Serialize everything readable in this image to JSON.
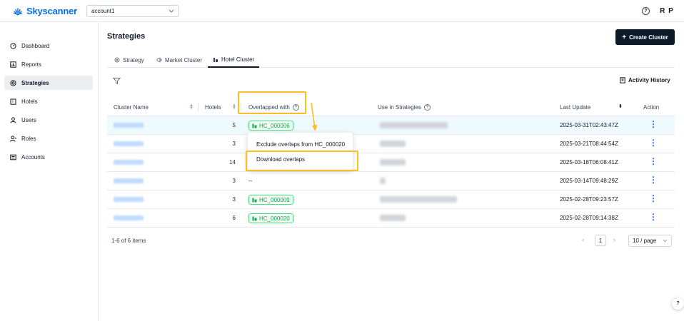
{
  "brand": {
    "name": "Skyscanner",
    "color": "#0770e3"
  },
  "account": {
    "value": "account1"
  },
  "user": {
    "initials": "R P"
  },
  "sidebar": {
    "items": [
      {
        "label": "Dashboard",
        "icon": "dashboard-icon",
        "active": false
      },
      {
        "label": "Reports",
        "icon": "reports-icon",
        "active": false
      },
      {
        "label": "Strategies",
        "icon": "strategies-icon",
        "active": true
      },
      {
        "label": "Hotels",
        "icon": "hotels-icon",
        "active": false
      },
      {
        "label": "Users",
        "icon": "users-icon",
        "active": false
      },
      {
        "label": "Roles",
        "icon": "roles-icon",
        "active": false
      },
      {
        "label": "Accounts",
        "icon": "accounts-icon",
        "active": false
      }
    ]
  },
  "main": {
    "title": "Strategies",
    "create_button": "Create Cluster",
    "tabs": [
      {
        "label": "Strategy",
        "active": false
      },
      {
        "label": "Market Cluster",
        "active": false
      },
      {
        "label": "Hotel Cluster",
        "active": true
      }
    ],
    "activity_history": "Activity History"
  },
  "table": {
    "columns": {
      "cluster_name": "Cluster Name",
      "hotels": "Hotels",
      "overlapped_with": "Overlapped with",
      "use_in_strategies": "Use in Strategies",
      "last_update": "Last Update",
      "action": "Action"
    },
    "rows": [
      {
        "hotels": "5",
        "overlapped": "HC_000006",
        "last_update": "2025-03-31T02:43:47Z"
      },
      {
        "hotels": "3",
        "overlapped": "",
        "last_update": "2025-03-21T08:44:54Z"
      },
      {
        "hotels": "14",
        "overlapped": "",
        "last_update": "2025-03-18T06:08:41Z"
      },
      {
        "hotels": "3",
        "overlapped": "--",
        "last_update": "2025-03-14T09:48:29Z"
      },
      {
        "hotels": "3",
        "overlapped": "HC_000009",
        "last_update": "2025-02-28T09:23:57Z"
      },
      {
        "hotels": "6",
        "overlapped": "HC_000020",
        "last_update": "2025-02-28T09:14:38Z"
      }
    ]
  },
  "popup": {
    "items": [
      "Exclude overlaps from HC_000020",
      "Download overlaps"
    ]
  },
  "pagination": {
    "summary": "1-6 of 6 items",
    "current_page": "1",
    "page_size": "10 / page"
  }
}
